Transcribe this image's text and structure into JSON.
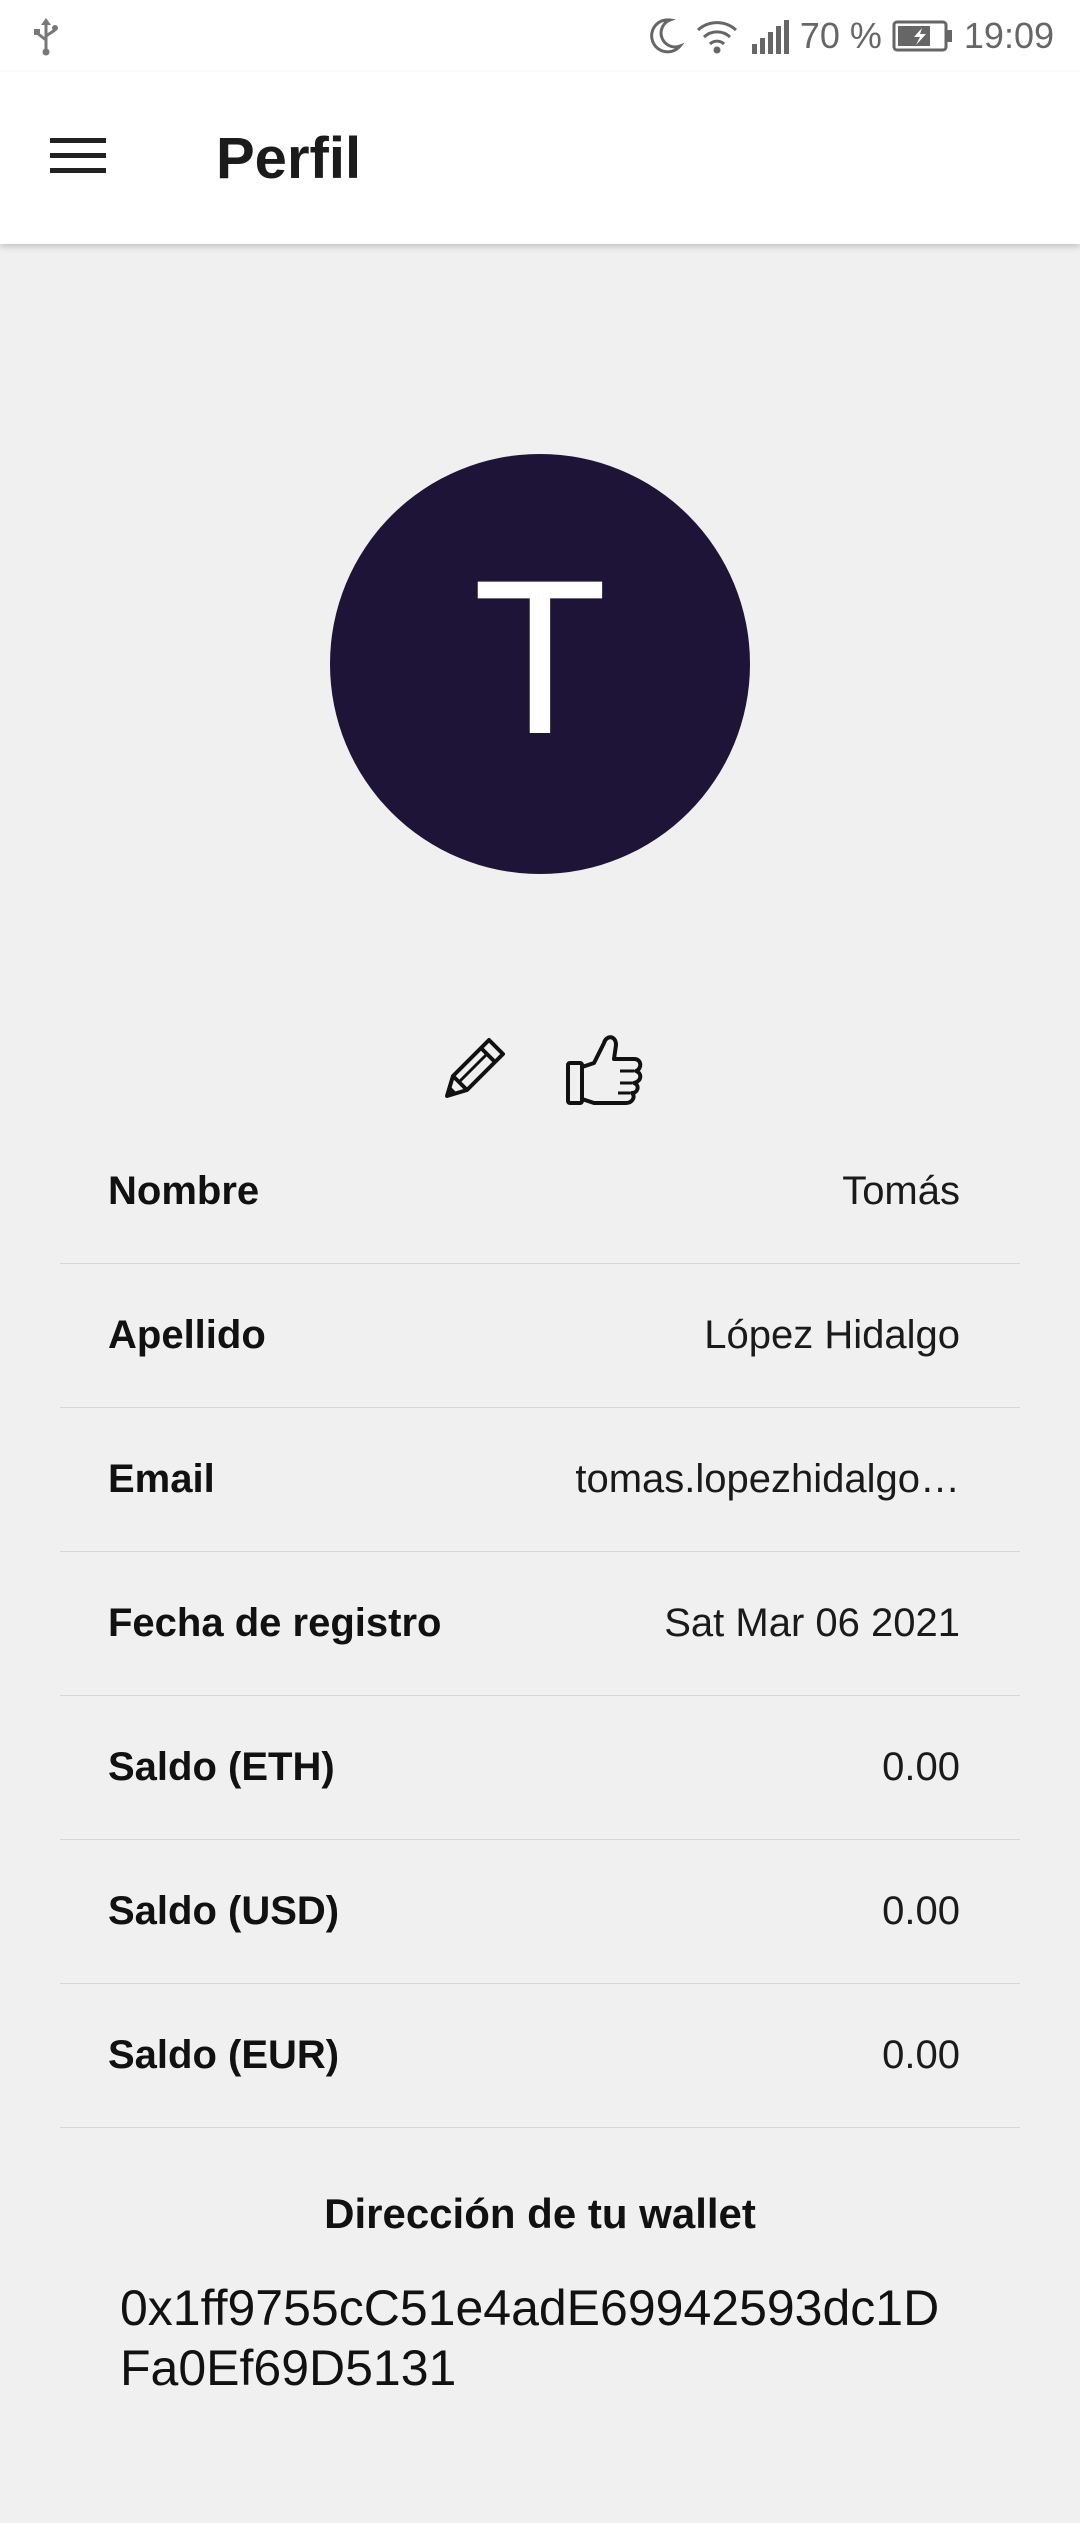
{
  "status_bar": {
    "battery_text": "70 %",
    "time": "19:09",
    "icons": [
      "usb-icon",
      "moon-icon",
      "wifi-icon",
      "signal-icon",
      "battery-icon"
    ]
  },
  "app_bar": {
    "title": "Perfil",
    "menu_icon": "hamburger-menu-icon"
  },
  "avatar": {
    "initial": "T",
    "background_color": "#1e1437"
  },
  "actions": {
    "edit_icon": "pencil-icon",
    "like_icon": "thumbs-up-icon"
  },
  "profile_fields": [
    {
      "label": "Nombre",
      "value": "Tomás"
    },
    {
      "label": "Apellido",
      "value": "López Hidalgo"
    },
    {
      "label": "Email",
      "value": "tomas.lopezhidalgo…"
    },
    {
      "label": "Fecha de registro",
      "value": "Sat Mar 06 2021"
    },
    {
      "label": "Saldo (ETH)",
      "value": "0.00"
    },
    {
      "label": "Saldo (USD)",
      "value": "0.00"
    },
    {
      "label": "Saldo (EUR)",
      "value": "0.00"
    }
  ],
  "wallet": {
    "title": "Dirección de tu wallet",
    "address": "0x1ff9755cC51e4adE69942593dc1DFa0Ef69D5131"
  },
  "colors": {
    "background": "#f0f0f0",
    "app_bar": "#ffffff",
    "avatar": "#1e1437",
    "divider": "#d8d8d8"
  }
}
